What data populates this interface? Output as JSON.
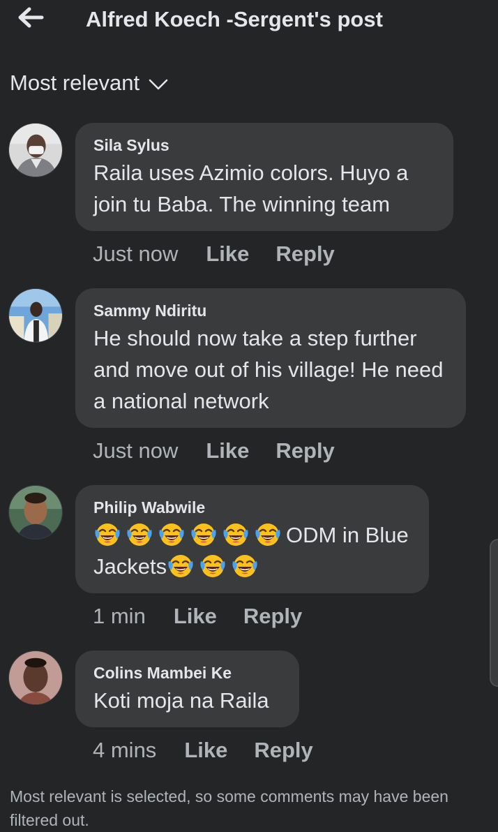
{
  "header": {
    "title": "Alfred Koech -Sergent's post",
    "back_icon": "arrow-left-icon"
  },
  "sort": {
    "label": "Most relevant",
    "icon": "chevron-down-icon"
  },
  "actions": {
    "like": "Like",
    "reply": "Reply"
  },
  "comments": [
    {
      "author": "Sila Sylus",
      "text": "Raila uses Azimio colors. Huyo a join tu Baba. The winning team",
      "time": "Just now"
    },
    {
      "author": "Sammy Ndiritu",
      "text": "He should now take a step further and move out of his village! He need a national network",
      "time": "Just now"
    },
    {
      "author": "Philip Wabwile",
      "text_after_emojis": "ODM in Blue",
      "text_line2": "Jackets",
      "emoji": "face-with-tears-of-joy-icon",
      "emoji_count_line1": 6,
      "emoji_count_line2": 3,
      "time": "1 min"
    },
    {
      "author": "Colins Mambei Ke",
      "text": "Koti moja na Raila",
      "time": "4 mins"
    }
  ],
  "footer_note": "Most relevant is selected, so some comments may have been filtered out.",
  "colors": {
    "background": "#242526",
    "bubble": "#3a3b3c",
    "text": "#e4e6eb",
    "muted": "#b0b3b8"
  }
}
